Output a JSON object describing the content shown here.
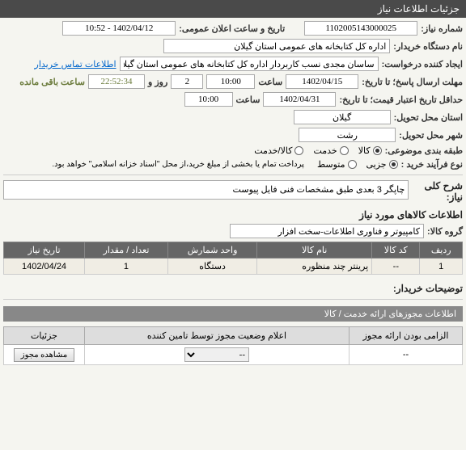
{
  "header": {
    "title": "جزئیات اطلاعات نیاز"
  },
  "fields": {
    "need_no_label": "شماره نیاز:",
    "need_no": "1102005143000025",
    "announce_label": "تاریخ و ساعت اعلان عمومی:",
    "announce": "1402/04/12 - 10:52",
    "buyer_org_label": "نام دستگاه خریدار:",
    "buyer_org": "اداره کل کتابخانه های عمومی استان گیلان",
    "requester_label": "ایجاد کننده درخواست:",
    "requester": "ساسان مجدی نسب کاربردار اداره کل کتابخانه های عمومی استان گیلان",
    "contact_link": "اطلاعات تماس خریدار",
    "deadline_label": "مهلت ارسال پاسخ؛ تا تاریخ:",
    "deadline_date": "1402/04/15",
    "time_label": "ساعت",
    "deadline_time": "10:00",
    "days_label": "روز و",
    "days": "2",
    "remain_time": "22:52:34",
    "remain_label": "ساعت باقی مانده",
    "validity_label": "حداقل تاریخ اعتبار قیمت؛ تا تاریخ:",
    "validity_date": "1402/04/31",
    "validity_time": "10:00",
    "province_label": "استان محل تحویل:",
    "province": "گیلان",
    "city_label": "شهر محل تحویل:",
    "city": "رشت",
    "subject_class_label": "طبقه بندی موضوعی:",
    "class_kala": "کالا",
    "class_khedmat": "خدمت",
    "class_both": "کالا/خدمت",
    "process_label": "نوع فرآیند خرید :",
    "proc_small": "جزیی",
    "proc_medium": "متوسط",
    "payment_note": "پرداخت تمام یا بخشی از مبلغ خرید،از محل \"اسناد خزانه اسلامی\" خواهد بود."
  },
  "summary": {
    "title_label": "شرح کلی نیاز:",
    "title_text": "چاپگر 3 بعدی طبق مشخصات فنی فایل پیوست",
    "goods_section": "اطلاعات کالاهای مورد نیاز",
    "group_label": "گروه کالا:",
    "group_value": "کامپیوتر و فناوری اطلاعات-سخت افزار"
  },
  "table": {
    "headers": [
      "ردیف",
      "کد کالا",
      "نام کالا",
      "واحد شمارش",
      "تعداد / مقدار",
      "تاریخ نیاز"
    ],
    "rows": [
      {
        "idx": "1",
        "code": "--",
        "name": "پرینتر چند منظوره",
        "unit": "دستگاه",
        "qty": "1",
        "date": "1402/04/24"
      }
    ]
  },
  "buyer_notes_label": "توضیحات خریدار:",
  "permits": {
    "header": "اطلاعات مجوزهای ارائه خدمت / کالا",
    "cols": [
      "الزامی بودن ارائه مجوز",
      "اعلام وضعیت مجوز توسط تامین کننده",
      "جزئیات"
    ],
    "row": {
      "mandatory": "--",
      "status": "--",
      "btn": "مشاهده مجوز"
    }
  }
}
